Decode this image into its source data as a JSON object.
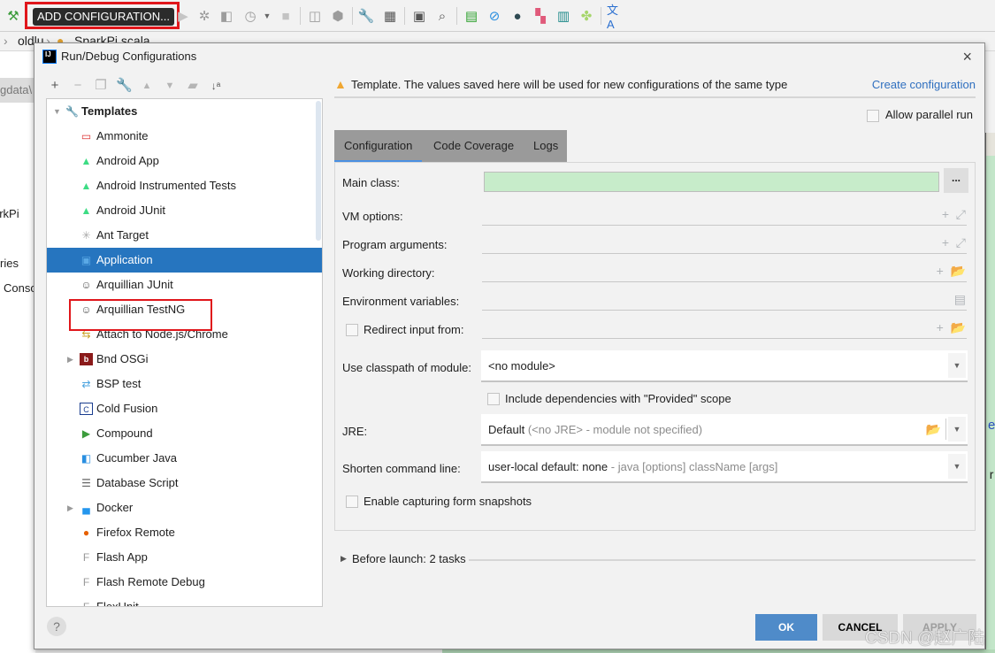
{
  "ide": {
    "add_configuration_label": "ADD CONFIGURATION...",
    "toolbar_icons": [
      "hammer-icon",
      "run-icon",
      "debug-icon",
      "coverage-icon",
      "profile-icon",
      "stop-icon",
      "attach-icon",
      "build-artifact-icon",
      "settings-wrench-icon",
      "project-structure-icon",
      "terminal-icon",
      "search-icon",
      "monitor-icon",
      "disable-icon",
      "record-icon",
      "layout-icon",
      "database-icon",
      "plugin-icon",
      "translate-icon"
    ],
    "breadcrumb": [
      "oldlu",
      "SparkPi.scala"
    ],
    "left_partial_texts": [
      "gdata\\",
      "arkPi",
      "ries",
      "Conso"
    ],
    "right_partial_texts": [
      "e",
      ". r"
    ]
  },
  "dialog": {
    "title": "Run/Debug Configurations",
    "close_label": "×",
    "tree": {
      "root_label": "Templates",
      "items": [
        {
          "label": "Ammonite",
          "icon": "ammonite-icon",
          "expandable": false
        },
        {
          "label": "Android App",
          "icon": "android-icon",
          "expandable": false
        },
        {
          "label": "Android Instrumented Tests",
          "icon": "android-test-icon",
          "expandable": false
        },
        {
          "label": "Android JUnit",
          "icon": "android-junit-icon",
          "expandable": false
        },
        {
          "label": "Ant Target",
          "icon": "ant-icon",
          "expandable": false
        },
        {
          "label": "Application",
          "icon": "application-icon",
          "expandable": false,
          "selected": true
        },
        {
          "label": "Arquillian JUnit",
          "icon": "arquillian-icon",
          "expandable": false
        },
        {
          "label": "Arquillian TestNG",
          "icon": "arquillian-icon",
          "expandable": false
        },
        {
          "label": "Attach to Node.js/Chrome",
          "icon": "nodejs-attach-icon",
          "expandable": false
        },
        {
          "label": "Bnd OSGi",
          "icon": "bnd-icon",
          "expandable": true
        },
        {
          "label": "BSP test",
          "icon": "bsp-icon",
          "expandable": false
        },
        {
          "label": "Cold Fusion",
          "icon": "coldfusion-icon",
          "expandable": false
        },
        {
          "label": "Compound",
          "icon": "compound-icon",
          "expandable": false
        },
        {
          "label": "Cucumber Java",
          "icon": "cucumber-icon",
          "expandable": false
        },
        {
          "label": "Database Script",
          "icon": "database-script-icon",
          "expandable": false
        },
        {
          "label": "Docker",
          "icon": "docker-icon",
          "expandable": true
        },
        {
          "label": "Firefox Remote",
          "icon": "firefox-icon",
          "expandable": false
        },
        {
          "label": "Flash App",
          "icon": "flash-icon",
          "expandable": false
        },
        {
          "label": "Flash Remote Debug",
          "icon": "flash-debug-icon",
          "expandable": false
        },
        {
          "label": "FlexUnit",
          "icon": "flash-icon",
          "expandable": false
        }
      ]
    },
    "warning_text": "Template. The values saved here will be used for new configurations of the same type",
    "create_configuration_link": "Create configuration",
    "allow_parallel_run": {
      "label": "Allow parallel run",
      "checked": false
    },
    "tabs": [
      {
        "label": "Configuration",
        "active": true
      },
      {
        "label": "Code Coverage",
        "active": false
      },
      {
        "label": "Logs",
        "active": false
      }
    ],
    "form": {
      "main_class": {
        "label": "Main class:",
        "value": "",
        "browse_label": "..."
      },
      "vm_options": {
        "label": "VM options:",
        "value": ""
      },
      "program_arguments": {
        "label": "Program arguments:",
        "value": ""
      },
      "working_directory": {
        "label": "Working directory:",
        "value": ""
      },
      "environment_variables": {
        "label": "Environment variables:",
        "value": ""
      },
      "redirect_input": {
        "label": "Redirect input from:",
        "checked": false,
        "value": ""
      },
      "classpath_module": {
        "label": "Use classpath of module:",
        "value": "<no module>"
      },
      "include_provided": {
        "label": "Include dependencies with \"Provided\" scope",
        "checked": false
      },
      "jre": {
        "label": "JRE:",
        "value": "Default",
        "hint": "(<no JRE> - module not specified)"
      },
      "shorten_command_line": {
        "label": "Shorten command line:",
        "value": "user-local default: none",
        "hint": "- java [options] className [args]"
      },
      "enable_snapshots": {
        "label": "Enable capturing form snapshots",
        "checked": false
      }
    },
    "before_launch": "Before launch: 2 tasks",
    "buttons": {
      "ok": "OK",
      "cancel": "CANCEL",
      "apply": "APPLY"
    },
    "help_label": "?"
  },
  "watermark": "CSDN @赵广陆"
}
